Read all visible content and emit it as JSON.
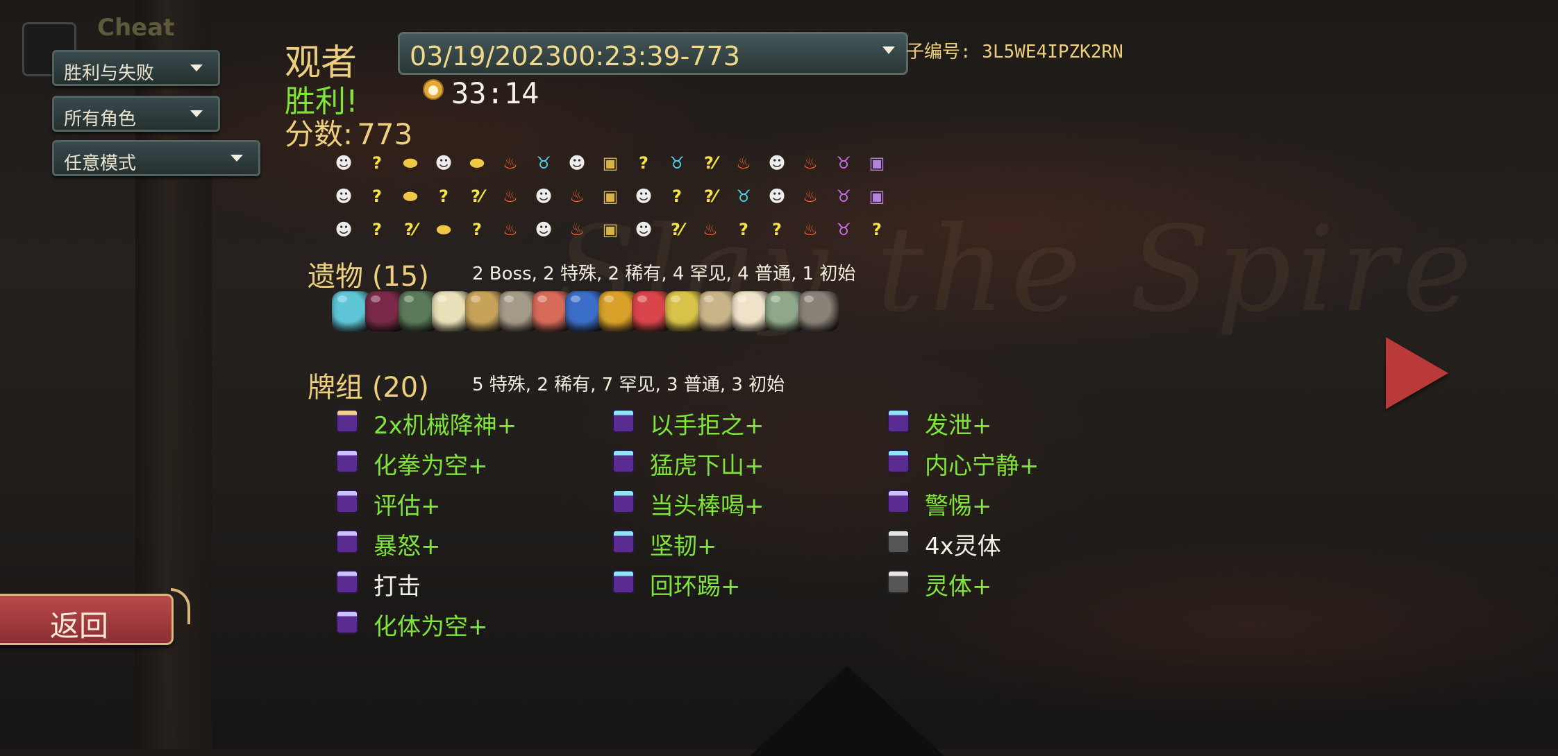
{
  "cheat": {
    "label": "Cheat"
  },
  "filters": {
    "result": "胜利与失败",
    "character": "所有角色",
    "mode": "任意模式"
  },
  "run": {
    "character": "观者",
    "selected_run": "03/19/202300:23:39-773",
    "seed_label": "子编号: 3L5WE4IPZK2RN",
    "result": "胜利!",
    "play_time": "33:14",
    "score_label": "分数:",
    "score": "773"
  },
  "path": {
    "rows": [
      [
        "monster",
        "event",
        "shop",
        "monster",
        "shop",
        "rest",
        "elite",
        "monster",
        "chest",
        "event",
        "elite",
        "eventm",
        "rest",
        "monster",
        "rest",
        "boss",
        "chestp"
      ],
      [
        "monster",
        "event",
        "shop",
        "event",
        "eventc",
        "rest",
        "monster",
        "rest",
        "chest",
        "monster",
        "event",
        "events",
        "elite",
        "monster",
        "rest",
        "boss",
        "chestp"
      ],
      [
        "monster",
        "event",
        "eventm",
        "shop",
        "event",
        "rest",
        "monster",
        "rest",
        "chest",
        "monster",
        "eventm",
        "rest",
        "event",
        "event",
        "rest",
        "boss",
        "event"
      ]
    ]
  },
  "relics": {
    "title": "遗物 (15)",
    "summary": "2  Boss, 2  特殊, 2  稀有, 4  罕见, 4  普通, 1  初始",
    "items": [
      {
        "name": "pure-water",
        "color": "#5fc6d8"
      },
      {
        "name": "runic-dome",
        "color": "#7a2a48"
      },
      {
        "name": "lantern",
        "color": "#5a7a5a"
      },
      {
        "name": "pen-nib",
        "color": "#e8e0b8"
      },
      {
        "name": "sundial",
        "color": "#c7a35a"
      },
      {
        "name": "bell",
        "color": "#a49a88"
      },
      {
        "name": "tag",
        "color": "#d86a5a"
      },
      {
        "name": "kettle",
        "color": "#3b6ec8"
      },
      {
        "name": "mango",
        "color": "#d9a12a"
      },
      {
        "name": "claw",
        "color": "#d9454a"
      },
      {
        "name": "quill",
        "color": "#d9c24a"
      },
      {
        "name": "scroll",
        "color": "#c9b48a"
      },
      {
        "name": "ice-cream",
        "color": "#f0e2c8"
      },
      {
        "name": "cage",
        "color": "#8fa88a"
      },
      {
        "name": "hourglass",
        "color": "#8a8278"
      }
    ]
  },
  "deck": {
    "title": "牌组 (20)",
    "summary": "5  特殊, 2  稀有, 7  罕见, 3  普通, 3  初始",
    "columns": [
      [
        {
          "label": "2x机械降神+",
          "upgraded": true,
          "top": "gold"
        },
        {
          "label": "化拳为空+",
          "upgraded": true,
          "top": "white"
        },
        {
          "label": "评估+",
          "upgraded": true,
          "top": "white"
        },
        {
          "label": "暴怒+",
          "upgraded": true,
          "top": "white"
        },
        {
          "label": "打击",
          "upgraded": false,
          "top": "white"
        },
        {
          "label": "化体为空+",
          "upgraded": true,
          "top": "white"
        }
      ],
      [
        {
          "label": "以手拒之+",
          "upgraded": true,
          "top": "skill"
        },
        {
          "label": "猛虎下山+",
          "upgraded": true,
          "top": "skill"
        },
        {
          "label": "当头棒喝+",
          "upgraded": true,
          "top": "skill"
        },
        {
          "label": "坚韧+",
          "upgraded": true,
          "top": "skill"
        },
        {
          "label": "回环踢+",
          "upgraded": true,
          "top": "skill"
        }
      ],
      [
        {
          "label": "发泄+",
          "upgraded": true,
          "top": "skill"
        },
        {
          "label": "内心宁静+",
          "upgraded": true,
          "top": "skill"
        },
        {
          "label": "警惕+",
          "upgraded": true,
          "top": "white"
        },
        {
          "label": "4x灵体",
          "upgraded": false,
          "top": "grey"
        },
        {
          "label": "灵体+",
          "upgraded": true,
          "top": "grey"
        }
      ]
    ]
  },
  "nav": {
    "back_label": "返回"
  },
  "background": {
    "watermark": "Slay the Spire"
  }
}
